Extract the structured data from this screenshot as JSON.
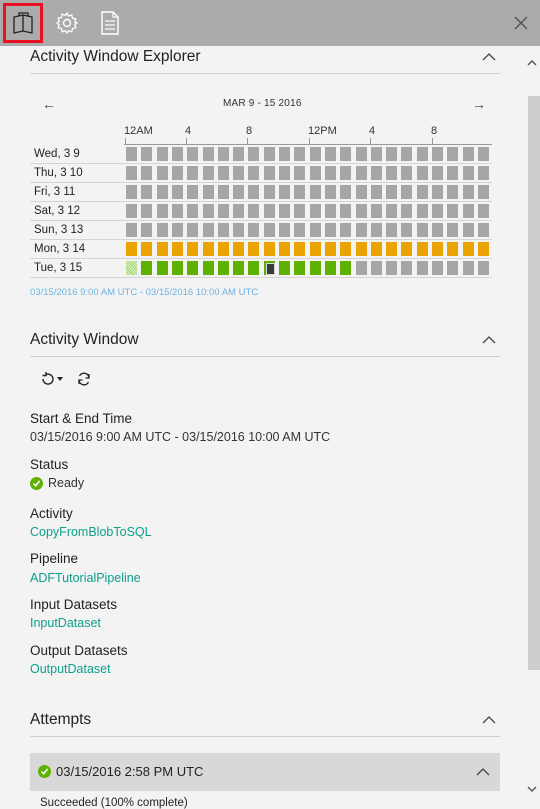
{
  "toolbar": {
    "tabs": [
      {
        "icon": "book-icon",
        "active": true
      },
      {
        "icon": "gear-icon",
        "active": false
      },
      {
        "icon": "document-icon",
        "active": false
      }
    ],
    "close_icon": "close-icon"
  },
  "explorer": {
    "title": "Activity Window Explorer",
    "prev": "←",
    "next": "→",
    "range": "MAR 9 - 15 2016",
    "hours": [
      "12AM",
      "4",
      "8",
      "12PM",
      "4",
      "8"
    ],
    "days": [
      {
        "label": "Wed, 3 9",
        "cells": [
          "g",
          "g",
          "g",
          "g",
          "g",
          "g",
          "g",
          "g",
          "g",
          "g",
          "g",
          "g",
          "g",
          "g",
          "g",
          "g",
          "g",
          "g",
          "g",
          "g",
          "g",
          "g",
          "g",
          "g"
        ]
      },
      {
        "label": "Thu, 3 10",
        "cells": [
          "g",
          "g",
          "g",
          "g",
          "g",
          "g",
          "g",
          "g",
          "g",
          "g",
          "g",
          "g",
          "g",
          "g",
          "g",
          "g",
          "g",
          "g",
          "g",
          "g",
          "g",
          "g",
          "g",
          "g"
        ]
      },
      {
        "label": "Fri, 3 11",
        "cells": [
          "g",
          "g",
          "g",
          "g",
          "g",
          "g",
          "g",
          "g",
          "g",
          "g",
          "g",
          "g",
          "g",
          "g",
          "g",
          "g",
          "g",
          "g",
          "g",
          "g",
          "g",
          "g",
          "g",
          "g"
        ]
      },
      {
        "label": "Sat, 3 12",
        "cells": [
          "g",
          "g",
          "g",
          "g",
          "g",
          "g",
          "g",
          "g",
          "g",
          "g",
          "g",
          "g",
          "g",
          "g",
          "g",
          "g",
          "g",
          "g",
          "g",
          "g",
          "g",
          "g",
          "g",
          "g"
        ]
      },
      {
        "label": "Sun, 3 13",
        "cells": [
          "g",
          "g",
          "g",
          "g",
          "g",
          "g",
          "g",
          "g",
          "g",
          "g",
          "g",
          "g",
          "g",
          "g",
          "g",
          "g",
          "g",
          "g",
          "g",
          "g",
          "g",
          "g",
          "g",
          "g"
        ]
      },
      {
        "label": "Mon, 3 14",
        "cells": [
          "o",
          "o",
          "o",
          "o",
          "o",
          "o",
          "o",
          "o",
          "o",
          "o",
          "o",
          "o",
          "o",
          "o",
          "o",
          "o",
          "o",
          "o",
          "o",
          "o",
          "o",
          "o",
          "o",
          "o"
        ]
      },
      {
        "label": "Tue, 3 15",
        "cells": [
          "d",
          "G",
          "G",
          "G",
          "G",
          "G",
          "G",
          "G",
          "G",
          "S",
          "G",
          "G",
          "G",
          "G",
          "G",
          "g",
          "g",
          "g",
          "g",
          "g",
          "g",
          "g",
          "g",
          "g"
        ]
      }
    ],
    "selection": "03/15/2016 9:00 AM UTC - 03/15/2016 10:00 AM UTC",
    "colors": {
      "gray": "#a6a6a6",
      "orange": "#eba303",
      "green": "#5eb001",
      "link": "#0d9e8a"
    }
  },
  "activity_window": {
    "title": "Activity Window",
    "start_end_label": "Start & End Time",
    "start_end_value": "03/15/2016 9:00 AM UTC - 03/15/2016 10:00 AM UTC",
    "status_label": "Status",
    "status_value": "Ready",
    "activity_label": "Activity",
    "activity_value": "CopyFromBlobToSQL",
    "pipeline_label": "Pipeline",
    "pipeline_value": "ADFTutorialPipeline",
    "input_label": "Input Datasets",
    "input_value": "InputDataset",
    "output_label": "Output Datasets",
    "output_value": "OutputDataset"
  },
  "attempts": {
    "title": "Attempts",
    "items": [
      {
        "time": "03/15/2016 2:58 PM UTC",
        "summary": "Succeeded (100% complete)"
      }
    ]
  }
}
